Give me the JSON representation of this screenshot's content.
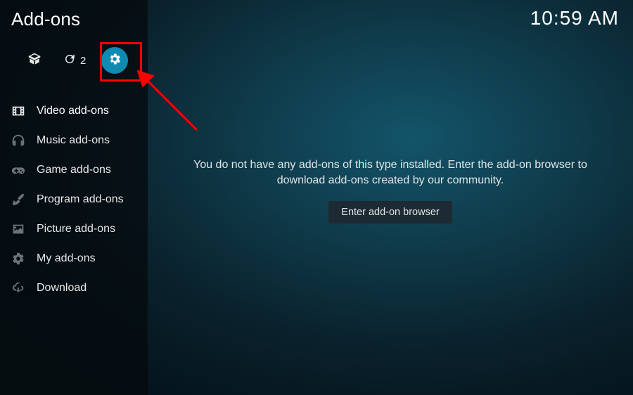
{
  "page_title": "Add-ons",
  "clock": "10:59 AM",
  "toolbar": {
    "refresh_count": "2"
  },
  "sidebar": {
    "items": [
      {
        "label": "Video add-ons"
      },
      {
        "label": "Music add-ons"
      },
      {
        "label": "Game add-ons"
      },
      {
        "label": "Program add-ons"
      },
      {
        "label": "Picture add-ons"
      },
      {
        "label": "My add-ons"
      },
      {
        "label": "Download"
      }
    ]
  },
  "content": {
    "empty_message": "You do not have any add-ons of this type installed. Enter the add-on browser to download add-ons created by our community.",
    "enter_button": "Enter add-on browser"
  },
  "colors": {
    "accent": "#0f8bb3",
    "highlight": "#ff0000"
  }
}
